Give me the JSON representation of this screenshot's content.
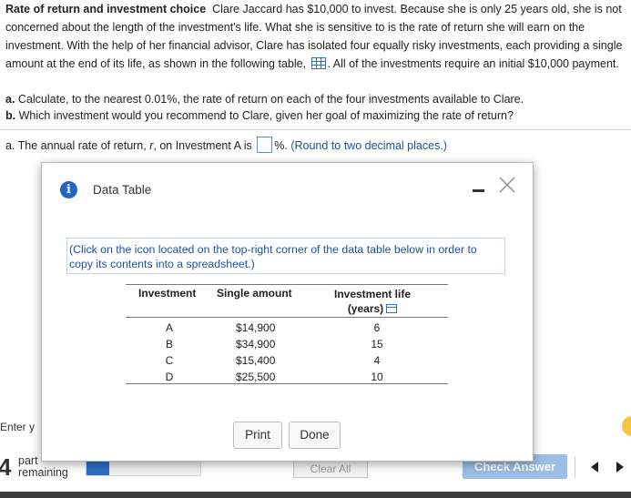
{
  "problem": {
    "title": "Rate of return and investment choice",
    "text_before_icon": "Clare Jaccard has $10,000 to invest. Because she is only 25 years old, she is not concerned about the length of the investment's life. What she is sensitive to is the rate of return she will earn on the investment. With the help of her financial advisor, Clare has isolated four equally risky investments, each providing a single amount at the end of its life, as shown in the following table,",
    "text_after_icon": ". All of the investments require an initial $10,000 payment."
  },
  "parts": [
    {
      "letter": "a.",
      "text": "Calculate, to the nearest 0.01%, the rate of return on each of the four investments available to Clare."
    },
    {
      "letter": "b.",
      "text": "Which investment would you recommend to Clare, given her goal of maximizing the rate of return?"
    }
  ],
  "question": {
    "prefix": "a. The annual rate of return, ",
    "variable": "r",
    "middle": ", on Investment A is",
    "answer_value": "",
    "suffix": "%.",
    "note": "(Round to two decimal places.)"
  },
  "dialog": {
    "title": "Data Table",
    "note": "(Click on the icon located on the top-right corner of the data table below in order to copy its contents into a spreadsheet.)",
    "columns": {
      "investment": "Investment",
      "amount": "Single amount",
      "life_line1": "Investment life",
      "life_line2": "(years)"
    },
    "rows": [
      {
        "investment": "A",
        "amount": "$14,900",
        "life": "6"
      },
      {
        "investment": "B",
        "amount": "$34,900",
        "life": "15"
      },
      {
        "investment": "C",
        "amount": "$15,400",
        "life": "4"
      },
      {
        "investment": "D",
        "amount": "$25,500",
        "life": "10"
      }
    ],
    "print_label": "Print",
    "done_label": "Done"
  },
  "footer": {
    "enter_label": "Enter y",
    "parts_count": "4",
    "parts_label_line1": "part",
    "parts_label_line2": "remaining",
    "progress_fraction": 0.2,
    "clear_all_label": "Clear All",
    "check_answer_label": "Check Answer"
  },
  "colors": {
    "accent": "#2164c4",
    "link_text": "#1f4f9b",
    "check_button": "#9cbde4"
  }
}
